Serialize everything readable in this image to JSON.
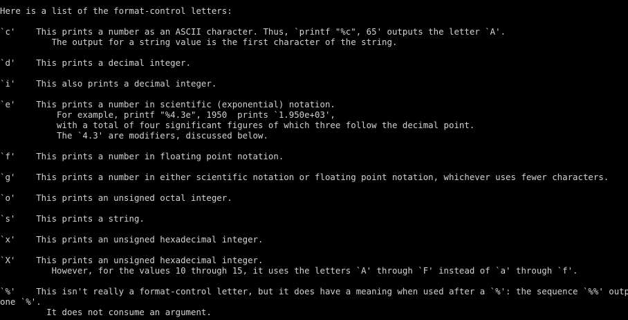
{
  "terminal": {
    "lines": [
      "Here is a list of the format-control letters:",
      "`c'    This prints a number as an ASCII character. Thus, `printf \"%c\", 65' outputs the letter `A'.",
      "          The output for a string value is the first character of the string.",
      "`d'    This prints a decimal integer.",
      "`i'    This also prints a decimal integer.",
      "`e'    This prints a number in scientific (exponential) notation.",
      "           For example, printf \"%4.3e\", 1950  prints `1.950e+03',",
      "           with a total of four significant figures of which three follow the decimal point.",
      "           The `4.3' are modifiers, discussed below.",
      "`f'    This prints a number in floating point notation.",
      "`g'    This prints a number in either scientific notation or floating point notation, whichever uses fewer characters.",
      "`o'    This prints an unsigned octal integer.",
      "`s'    This prints a string.",
      "`x'    This prints an unsigned hexadecimal integer.",
      "`X'    This prints an unsigned hexadecimal integer.",
      "          However, for the values 10 through 15, it uses the letters `A' through `F' instead of `a' through `f'.",
      "`%'    This isn't really a format-control letter, but it does have a meaning when used after a `%': the sequence `%%' outputs",
      "one `%'.",
      "         It does not consume an argument."
    ]
  },
  "colors": {
    "background": "#000000",
    "text": "#d3d3d3"
  }
}
